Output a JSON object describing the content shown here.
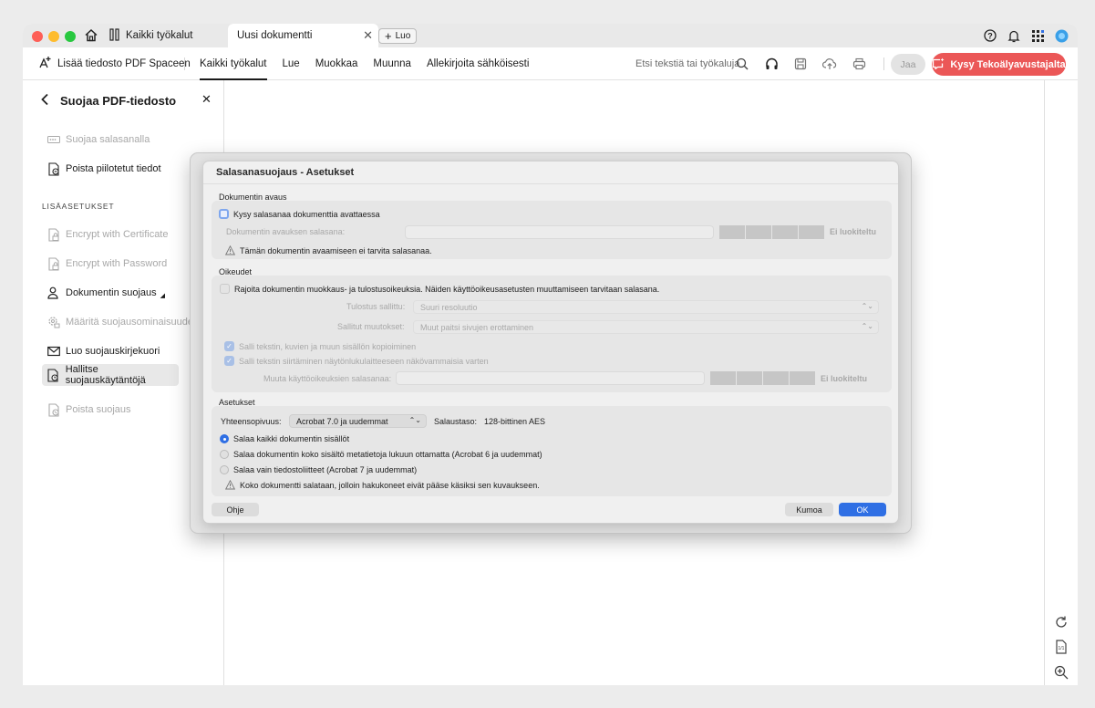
{
  "titlebar": {
    "tools_tab": "Kaikki työkalut",
    "doc_tab": "Uusi dokumentti",
    "new_tab": "Luo"
  },
  "toolbar": {
    "add_space": "Lisää tiedosto PDF Spaceen",
    "menu": [
      "Kaikki työkalut",
      "Lue",
      "Muokkaa",
      "Muunna",
      "Allekirjoita sähköisesti"
    ],
    "search_placeholder": "Etsi tekstiä tai työkaluja",
    "share": "Jaa",
    "ai_assistant": "Kysy Tekoälyavustajalta"
  },
  "leftpanel": {
    "title": "Suojaa PDF-tiedosto",
    "items": [
      {
        "label": "Suojaa salasanalla"
      },
      {
        "label": "Poista piilotetut tiedot"
      }
    ],
    "section": "LISÄASETUKSET",
    "advanced": [
      {
        "label": "Encrypt with Certificate"
      },
      {
        "label": "Encrypt with Password"
      },
      {
        "label": "Dokumentin suojaus"
      },
      {
        "label": "Määritä suojausominaisuudet"
      },
      {
        "label": "Luo suojauskirjekuori"
      },
      {
        "label": "Hallitse suojauskäytäntöjä"
      },
      {
        "label": "Poista suojaus"
      }
    ]
  },
  "dialog": {
    "title": "Salasanasuojaus - Asetukset",
    "open": {
      "heading": "Dokumentin avaus",
      "ask_password": "Kysy salasanaa dokumenttia avattaessa",
      "field_label": "Dokumentin avauksen salasana:",
      "strength": "Ei luokiteltu",
      "note": "Tämän dokumentin avaamiseen ei tarvita salasanaa."
    },
    "permissions": {
      "heading": "Oikeudet",
      "restrict": "Rajoita dokumentin muokkaus- ja tulostusoikeuksia. Näiden käyttöoikeusasetusten muuttamiseen tarvitaan salasana.",
      "print_label": "Tulostus sallittu:",
      "print_value": "Suuri resoluutio",
      "changes_label": "Sallitut muutokset:",
      "changes_value": "Muut paitsi sivujen erottaminen",
      "copy": "Salli tekstin, kuvien ja muun sisällön kopioiminen",
      "screenreader": "Salli tekstin siirtäminen näytönlukulaitteeseen näkövammaisia varten",
      "pw_label": "Muuta käyttöoikeuksien salasanaa:",
      "strength": "Ei luokiteltu"
    },
    "settings": {
      "heading": "Asetukset",
      "compat_label": "Yhteensopivuus:",
      "compat_value": "Acrobat 7.0 ja uudemmat",
      "enc_label": "Salaustaso:",
      "enc_value": "128-bittinen AES",
      "opt_all": "Salaa kaikki dokumentin sisällöt",
      "opt_except_meta": "Salaa dokumentin koko sisältö metatietoja lukuun ottamatta (Acrobat 6 ja uudemmat)",
      "opt_attachments": "Salaa vain tiedostoliitteet (Acrobat 7 ja uudemmat)",
      "note": "Koko dokumentti salataan, jolloin hakukoneet eivät pääse käsiksi sen kuvaukseen."
    },
    "help": "Ohje",
    "cancel": "Kumoa",
    "ok": "OK"
  }
}
